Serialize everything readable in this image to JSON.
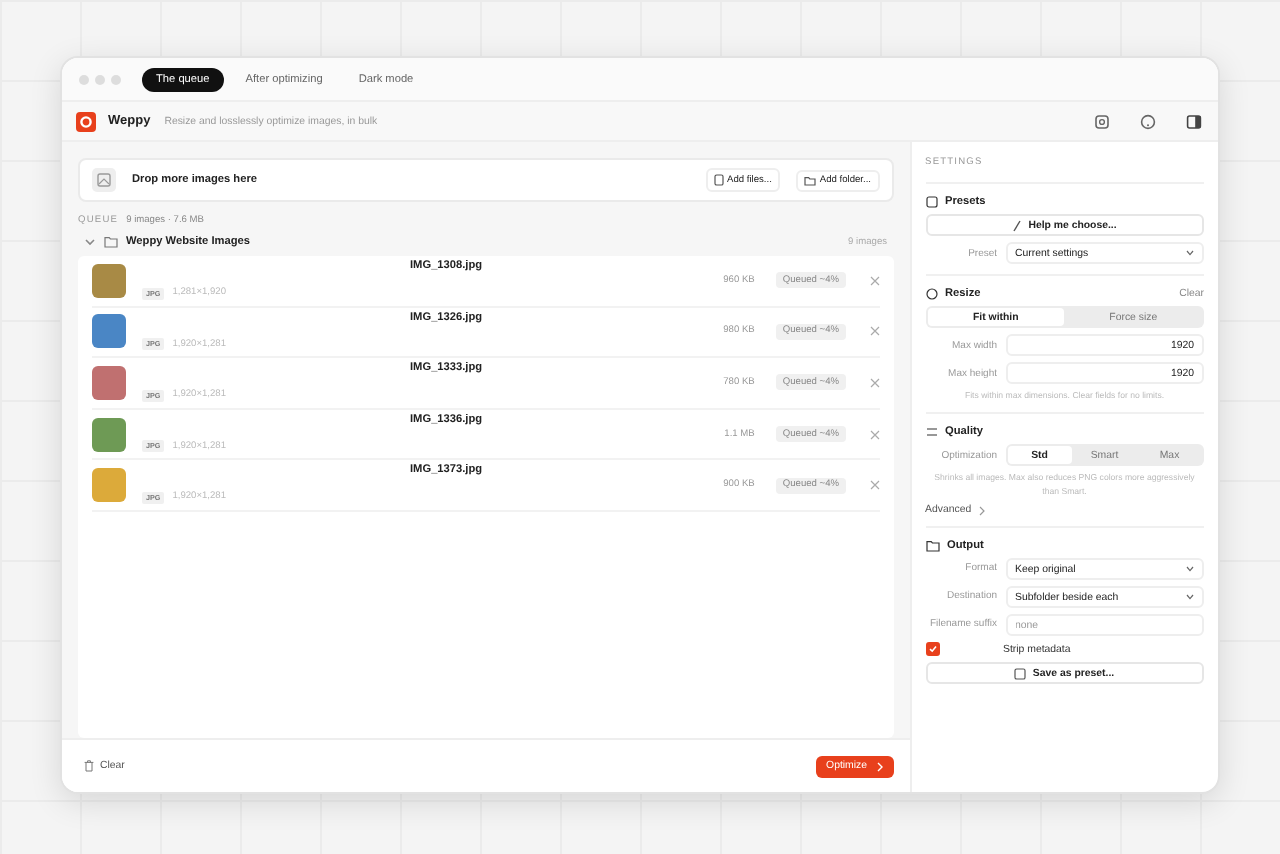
{
  "window": {
    "tabs": [
      {
        "label": "The queue",
        "selected": true
      },
      {
        "label": "After optimizing",
        "selected": false
      },
      {
        "label": "Dark mode",
        "selected": false
      }
    ]
  },
  "app": {
    "name": "Weppy",
    "tagline": "Resize and losslessly optimize images, in bulk"
  },
  "drop_zone": {
    "label": "Drop more images here",
    "add_files": "Add files...",
    "add_folder": "Add folder..."
  },
  "queue": {
    "label": "QUEUE",
    "summary": "9 images · 7.6 MB"
  },
  "group": {
    "name": "Weppy Website Images",
    "count": "9 images",
    "expanded": true
  },
  "files": [
    {
      "name": "IMG_1308.jpg",
      "format": "JPG",
      "dimensions": "1,281×1,920",
      "size": "960 KB",
      "status": "Queued ~4%",
      "color": "#a88a45"
    },
    {
      "name": "IMG_1326.jpg",
      "format": "JPG",
      "dimensions": "1,920×1,281",
      "size": "980 KB",
      "status": "Queued ~4%",
      "color": "#4a86c5"
    },
    {
      "name": "IMG_1333.jpg",
      "format": "JPG",
      "dimensions": "1,920×1,281",
      "size": "780 KB",
      "status": "Queued ~4%",
      "color": "#c07070"
    },
    {
      "name": "IMG_1336.jpg",
      "format": "JPG",
      "dimensions": "1,920×1,281",
      "size": "1.1 MB",
      "status": "Queued ~4%",
      "color": "#6e9a55"
    },
    {
      "name": "IMG_1373.jpg",
      "format": "JPG",
      "dimensions": "1,920×1,281",
      "size": "900 KB",
      "status": "Queued ~4%",
      "color": "#dcaa3a"
    }
  ],
  "footer": {
    "clear": "Clear",
    "optimize": "Optimize"
  },
  "settings": {
    "title": "SETTINGS",
    "presets": {
      "title": "Presets",
      "help_button": "Help me choose...",
      "preset_label": "Preset",
      "preset_value": "Current settings"
    },
    "resize": {
      "title": "Resize",
      "clear": "Clear",
      "modes": [
        {
          "label": "Fit within",
          "selected": true
        },
        {
          "label": "Force size",
          "selected": false
        }
      ],
      "fields": [
        {
          "label": "Max width",
          "value": "1920"
        },
        {
          "label": "Max height",
          "value": "1920"
        }
      ],
      "hint": "Fits within max dimensions. Clear fields for no limits."
    },
    "quality": {
      "title": "Quality",
      "label": "Optimization",
      "levels": [
        {
          "label": "Std",
          "selected": true
        },
        {
          "label": "Smart",
          "selected": false
        },
        {
          "label": "Max",
          "selected": false
        }
      ],
      "hint": "Shrinks all images. Max also reduces PNG colors more aggressively than Smart.",
      "advanced": "Advanced"
    },
    "output": {
      "title": "Output",
      "fields": [
        {
          "label": "Format",
          "value": "Keep original",
          "kind": "select"
        },
        {
          "label": "Destination",
          "value": "Subfolder beside each",
          "kind": "select"
        },
        {
          "label": "Filename suffix",
          "placeholder": "none",
          "kind": "input"
        }
      ],
      "strip": {
        "label": "Strip metadata",
        "checked": true
      },
      "save_button": "Save as preset..."
    }
  }
}
